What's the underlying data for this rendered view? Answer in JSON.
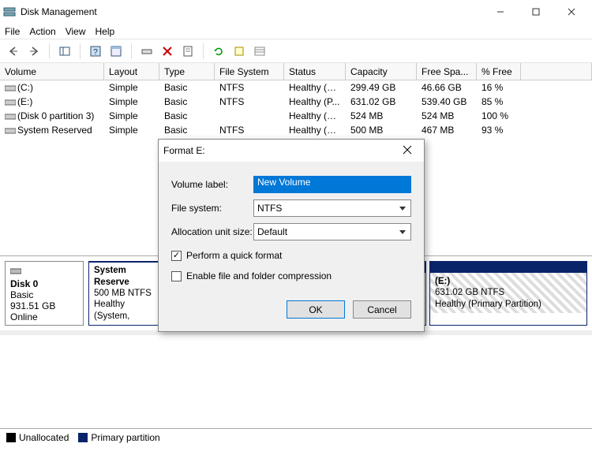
{
  "window": {
    "title": "Disk Management"
  },
  "menus": [
    "File",
    "Action",
    "View",
    "Help"
  ],
  "columns": {
    "vol": "Volume",
    "layout": "Layout",
    "type": "Type",
    "fs": "File System",
    "status": "Status",
    "cap": "Capacity",
    "free": "Free Spa...",
    "pct": "% Free"
  },
  "volumes": [
    {
      "vol": "(C:)",
      "layout": "Simple",
      "type": "Basic",
      "fs": "NTFS",
      "status": "Healthy (B...",
      "cap": "299.49 GB",
      "free": "46.66 GB",
      "pct": "16 %"
    },
    {
      "vol": "(E:)",
      "layout": "Simple",
      "type": "Basic",
      "fs": "NTFS",
      "status": "Healthy (P...",
      "cap": "631.02 GB",
      "free": "539.40 GB",
      "pct": "85 %"
    },
    {
      "vol": "(Disk 0 partition 3)",
      "layout": "Simple",
      "type": "Basic",
      "fs": "",
      "status": "Healthy (R...",
      "cap": "524 MB",
      "free": "524 MB",
      "pct": "100 %"
    },
    {
      "vol": "System Reserved",
      "layout": "Simple",
      "type": "Basic",
      "fs": "NTFS",
      "status": "Healthy (S...",
      "cap": "500 MB",
      "free": "467 MB",
      "pct": "93 %"
    }
  ],
  "disk": {
    "name": "Disk 0",
    "type": "Basic",
    "size": "931.51 GB",
    "status": "Online"
  },
  "partitions": {
    "sysres": {
      "name": "System Reserve",
      "l2": "500 MB NTFS",
      "l3": "Healthy (System,"
    },
    "e": {
      "name": "(E:)",
      "l2": "631.02 GB NTFS",
      "l3": "Healthy (Primary Partition)"
    }
  },
  "legend": {
    "unallocated": "Unallocated",
    "primary": "Primary partition"
  },
  "dialog": {
    "title": "Format E:",
    "labels": {
      "vlabel": "Volume label:",
      "fs": "File system:",
      "alloc": "Allocation unit size:"
    },
    "values": {
      "vlabel": "New Volume",
      "fs": "NTFS",
      "alloc": "Default"
    },
    "checks": {
      "quick": "Perform a quick format",
      "compress": "Enable file and folder compression"
    },
    "buttons": {
      "ok": "OK",
      "cancel": "Cancel"
    }
  }
}
